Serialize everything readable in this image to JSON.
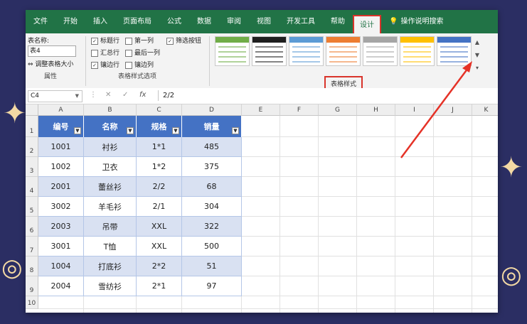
{
  "tabs": [
    "文件",
    "开始",
    "插入",
    "页面布局",
    "公式",
    "数据",
    "审阅",
    "视图",
    "开发工具",
    "帮助"
  ],
  "active_tab": "设计",
  "search_tab": "操作说明搜索",
  "properties": {
    "name_label": "表名称:",
    "name_value": "表4",
    "resize_label": "调整表格大小",
    "group_label": "属性"
  },
  "style_options": {
    "col1": [
      "标题行",
      "汇总行",
      "镶边行"
    ],
    "col1_checked": [
      true,
      false,
      true
    ],
    "col2": [
      "第一列",
      "最后一列",
      "镶边列"
    ],
    "col2_checked": [
      false,
      false,
      false
    ],
    "filter_button": "筛选按钮",
    "filter_checked": true,
    "group_label": "表格样式选项"
  },
  "table_styles_label": "表格样式",
  "swatch_colors": [
    "#70ad47",
    "#1f1f1f",
    "#5b9bd5",
    "#ed7d31",
    "#a5a5a5",
    "#ffc000",
    "#4472c4"
  ],
  "formula_bar": {
    "cell_ref": "C4",
    "fx": "fx",
    "value": "2/2"
  },
  "columns": [
    "A",
    "B",
    "C",
    "D",
    "E",
    "F",
    "G",
    "H",
    "I",
    "J",
    "K"
  ],
  "rows": [
    "1",
    "2",
    "3",
    "4",
    "5",
    "6",
    "7",
    "8",
    "9",
    "10"
  ],
  "table": {
    "headers": [
      "编号",
      "名称",
      "规格",
      "销量"
    ],
    "rows": [
      [
        "1001",
        "衬衫",
        "1*1",
        "485"
      ],
      [
        "1002",
        "卫衣",
        "1*2",
        "375"
      ],
      [
        "2001",
        "蕾丝衫",
        "2/2",
        "68"
      ],
      [
        "3002",
        "羊毛衫",
        "2/1",
        "304"
      ],
      [
        "2003",
        "吊带",
        "XXL",
        "322"
      ],
      [
        "3001",
        "T恤",
        "XXL",
        "500"
      ],
      [
        "1004",
        "打底衫",
        "2*2",
        "51"
      ],
      [
        "2004",
        "雪纺衫",
        "2*1",
        "97"
      ]
    ]
  },
  "colors": {
    "header_fill": "#4472c4",
    "band_fill": "#d9e1f2",
    "ribbon_green": "#217346",
    "highlight_red": "#d9342b"
  }
}
